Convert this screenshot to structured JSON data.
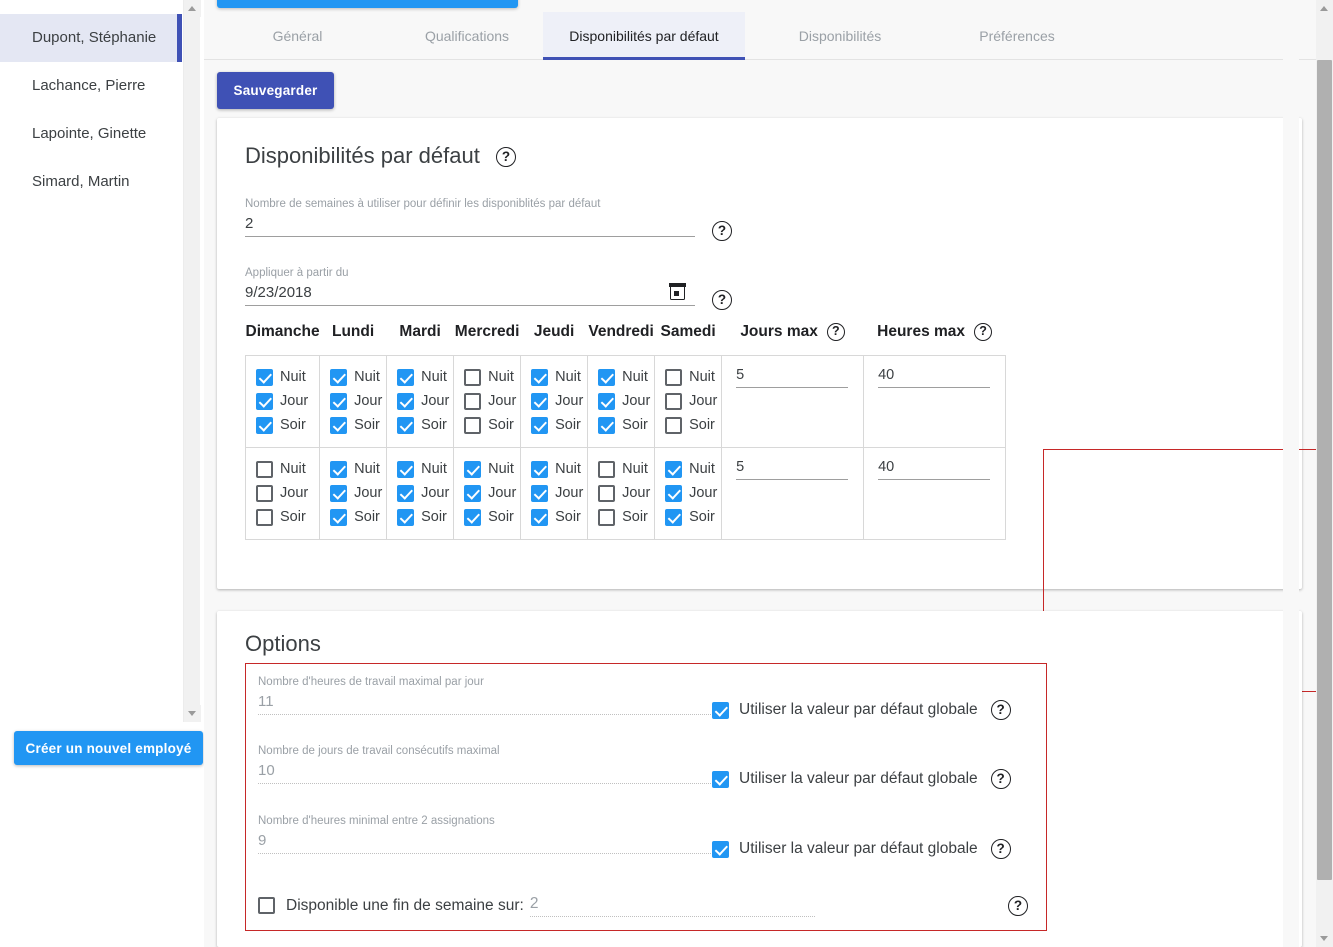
{
  "sidebar": {
    "employees": [
      {
        "name": "Dupont, Stéphanie",
        "selected": true
      },
      {
        "name": "Lachance, Pierre",
        "selected": false
      },
      {
        "name": "Lapointe, Ginette",
        "selected": false
      },
      {
        "name": "Simard, Martin",
        "selected": false
      }
    ],
    "new_employee_label": "Créer un nouvel employé"
  },
  "tabs": [
    {
      "label": "Général",
      "active": false
    },
    {
      "label": "Qualifications",
      "active": false
    },
    {
      "label": "Disponibilités par défaut",
      "active": true
    },
    {
      "label": "Disponibilités",
      "active": false
    },
    {
      "label": "Préférences",
      "active": false
    }
  ],
  "toolbar": {
    "save_label": "Sauvegarder"
  },
  "dispo_card": {
    "title": "Disponibilités par défaut",
    "weeks_field": {
      "label": "Nombre de semaines à utiliser pour définir les disponiblités par défaut",
      "value": "2"
    },
    "start_field": {
      "label": "Appliquer à partir du",
      "value": "9/23/2018"
    },
    "day_headers": [
      "Dimanche",
      "Lundi",
      "Mardi",
      "Mercredi",
      "Jeudi",
      "Vendredi",
      "Samedi"
    ],
    "shift_labels": [
      "Nuit",
      "Jour",
      "Soir"
    ],
    "max_days_header": "Jours max",
    "max_hours_header": "Heures max",
    "rows": [
      {
        "days": [
          [
            true,
            true,
            true
          ],
          [
            true,
            true,
            true
          ],
          [
            true,
            true,
            true
          ],
          [
            false,
            false,
            false
          ],
          [
            true,
            true,
            true
          ],
          [
            true,
            true,
            true
          ],
          [
            false,
            false,
            false
          ]
        ],
        "max_days": "5",
        "max_hours": "40"
      },
      {
        "days": [
          [
            false,
            false,
            false
          ],
          [
            true,
            true,
            true
          ],
          [
            true,
            true,
            true
          ],
          [
            true,
            true,
            true
          ],
          [
            true,
            true,
            true
          ],
          [
            false,
            false,
            false
          ],
          [
            true,
            true,
            true
          ]
        ],
        "max_days": "5",
        "max_hours": "40"
      }
    ]
  },
  "options_card": {
    "title": "Options",
    "global_default_label": "Utiliser la valeur par défaut globale",
    "rows": [
      {
        "label": "Nombre d'heures de travail maximal par jour",
        "value": "11",
        "use_global": true
      },
      {
        "label": "Nombre de jours de travail consécutifs maximal",
        "value": "10",
        "use_global": true
      },
      {
        "label": "Nombre d'heures minimal entre 2 assignations",
        "value": "9",
        "use_global": true
      }
    ],
    "weekend": {
      "checked": false,
      "label": "Disponible une fin de semaine sur:",
      "value": "2"
    }
  },
  "icons": {
    "help": "?",
    "calendar": "calendar-icon",
    "scroll_up": "scroll-up-arrow",
    "scroll_down": "scroll-down-arrow"
  },
  "colors": {
    "accent_blue": "#2196f3",
    "indigo": "#3f51b5",
    "highlight_red": "#c62828",
    "selected_bg": "#e4e7f3"
  }
}
